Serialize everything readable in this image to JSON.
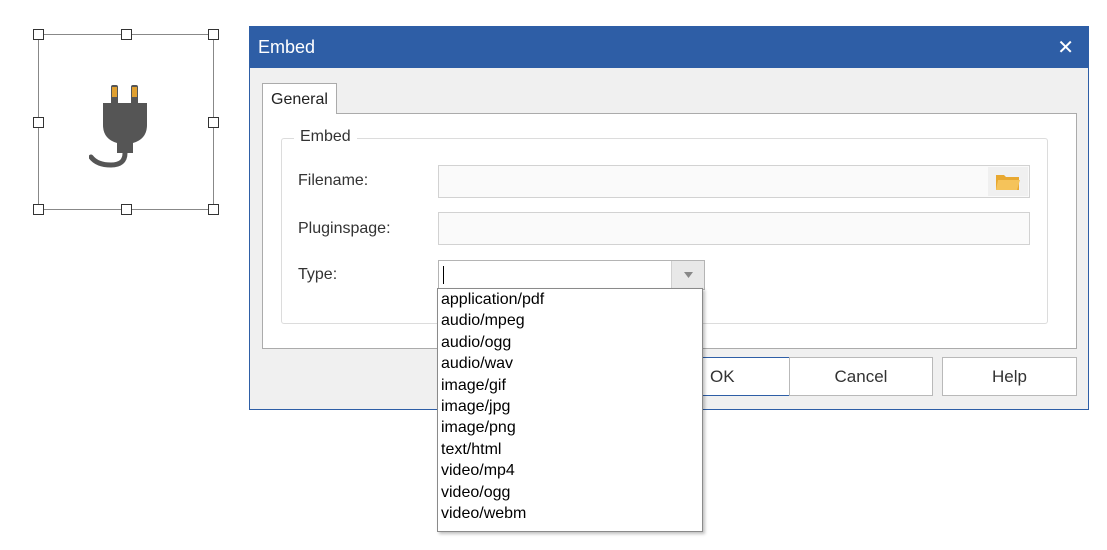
{
  "dialog": {
    "title": "Embed",
    "close_icon": "close-icon",
    "tab_label": "General",
    "group_title": "Embed",
    "filename_label": "Filename:",
    "filename_value": "",
    "pluginspage_label": "Pluginspage:",
    "pluginspage_value": "",
    "type_label": "Type:",
    "type_value": "",
    "buttons": {
      "ok": "OK",
      "cancel": "Cancel",
      "help": "Help"
    }
  },
  "type_options": [
    "application/pdf",
    "audio/mpeg",
    "audio/ogg",
    "audio/wav",
    "image/gif",
    "image/jpg",
    "image/png",
    "text/html",
    "video/mp4",
    "video/ogg",
    "video/webm"
  ],
  "colors": {
    "titlebar": "#2e5ea6",
    "plug": "#555555",
    "plug_pins": "#e0a030",
    "folder": "#f0b040"
  },
  "icons": {
    "object": "plug-icon",
    "browse": "folder-icon",
    "dropdown": "chevron-down-icon"
  }
}
